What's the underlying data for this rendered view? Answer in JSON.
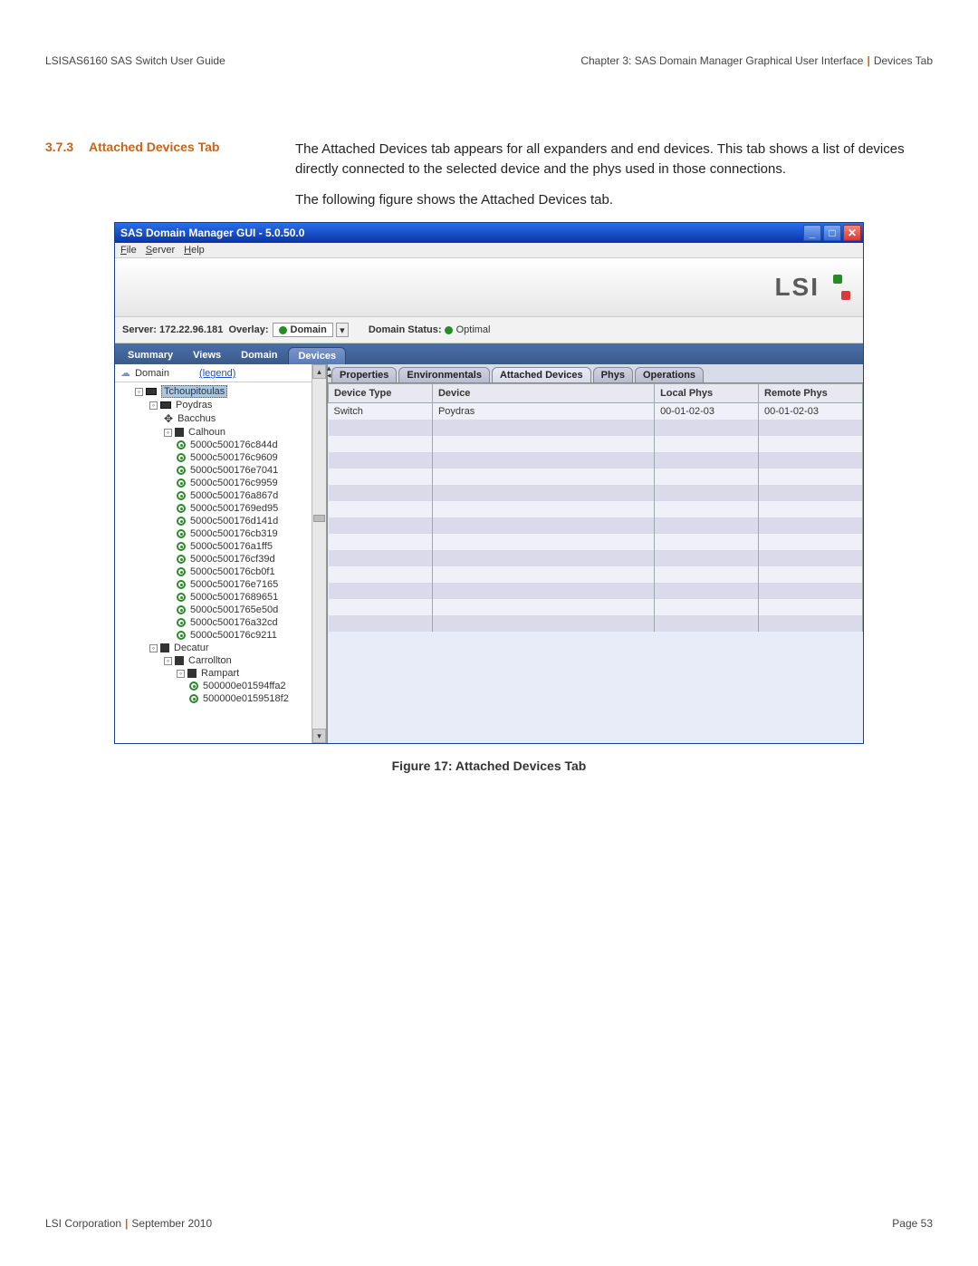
{
  "header": {
    "left": "LSISAS6160 SAS Switch User Guide",
    "right_chapter": "Chapter 3: SAS Domain Manager Graphical User Interface",
    "right_tab": "Devices Tab"
  },
  "section": {
    "number": "3.7.3",
    "title": "Attached Devices Tab",
    "p1": "The Attached Devices tab appears for all expanders and end devices. This tab shows a list of devices directly connected to the selected device and the phys used in those connections.",
    "p2": "The following figure shows the Attached Devices tab."
  },
  "figure_caption": "Figure 17:   Attached Devices Tab",
  "footer": {
    "left_a": "LSI Corporation",
    "left_b": "September 2010",
    "right": "Page 53"
  },
  "app": {
    "title": "SAS Domain Manager GUI - 5.0.50.0",
    "menus": [
      {
        "label": "File",
        "prefix": "F",
        "rest": "ile"
      },
      {
        "label": "Server",
        "prefix": "S",
        "rest": "erver"
      },
      {
        "label": "Help",
        "prefix": "H",
        "rest": "elp"
      }
    ],
    "logo": "LSI",
    "status_bar": {
      "server_label": "Server:",
      "server_value": "172.22.96.181",
      "overlay_label": "Overlay:",
      "overlay_value": "Domain",
      "domain_status_label": "Domain Status:",
      "domain_status_value": "Optimal"
    },
    "nav_tabs": [
      "Summary",
      "Views",
      "Domain",
      "Devices"
    ],
    "nav_active": "Devices",
    "tree": {
      "root_label": "Domain",
      "legend": "(legend)",
      "nodes": [
        {
          "label": "Tchoupitoulas",
          "icon": "switch",
          "indent": 1,
          "selected": true,
          "toggle": "open"
        },
        {
          "label": "Poydras",
          "icon": "switch",
          "indent": 2,
          "toggle": "open"
        },
        {
          "label": "Bacchus",
          "icon": "initiator",
          "indent": 3
        },
        {
          "label": "Calhoun",
          "icon": "enclosure",
          "indent": 3,
          "toggle": "open"
        },
        {
          "label": "5000c500176c844d",
          "icon": "disk",
          "indent": 4
        },
        {
          "label": "5000c500176c9609",
          "icon": "disk",
          "indent": 4
        },
        {
          "label": "5000c500176e7041",
          "icon": "disk",
          "indent": 4
        },
        {
          "label": "5000c500176c9959",
          "icon": "disk",
          "indent": 4
        },
        {
          "label": "5000c500176a867d",
          "icon": "disk",
          "indent": 4
        },
        {
          "label": "5000c5001769ed95",
          "icon": "disk",
          "indent": 4
        },
        {
          "label": "5000c500176d141d",
          "icon": "disk",
          "indent": 4
        },
        {
          "label": "5000c500176cb319",
          "icon": "disk",
          "indent": 4
        },
        {
          "label": "5000c500176a1ff5",
          "icon": "disk",
          "indent": 4
        },
        {
          "label": "5000c500176cf39d",
          "icon": "disk",
          "indent": 4
        },
        {
          "label": "5000c500176cb0f1",
          "icon": "disk",
          "indent": 4
        },
        {
          "label": "5000c500176e7165",
          "icon": "disk",
          "indent": 4
        },
        {
          "label": "5000c50017689651",
          "icon": "disk",
          "indent": 4
        },
        {
          "label": "5000c5001765e50d",
          "icon": "disk",
          "indent": 4
        },
        {
          "label": "5000c500176a32cd",
          "icon": "disk",
          "indent": 4
        },
        {
          "label": "5000c500176c9211",
          "icon": "disk",
          "indent": 4
        },
        {
          "label": "Decatur",
          "icon": "enclosure",
          "indent": 2,
          "toggle": "open"
        },
        {
          "label": "Carrollton",
          "icon": "enclosure",
          "indent": 3,
          "toggle": "open"
        },
        {
          "label": "Rampart",
          "icon": "enclosure",
          "indent": 4,
          "toggle": "open"
        },
        {
          "label": "500000e01594ffa2",
          "icon": "disk",
          "indent": 5
        },
        {
          "label": "500000e0159518f2",
          "icon": "disk",
          "indent": 5
        }
      ]
    },
    "detail_tabs": [
      "Properties",
      "Environmentals",
      "Attached Devices",
      "Phys",
      "Operations"
    ],
    "detail_active": "Attached Devices",
    "table": {
      "headers": [
        "Device Type",
        "Device",
        "Local Phys",
        "Remote Phys"
      ],
      "rows": [
        {
          "device_type": "Switch",
          "device": "Poydras",
          "local_phys": "00-01-02-03",
          "remote_phys": "00-01-02-03"
        }
      ],
      "empty_rows": 13
    }
  }
}
